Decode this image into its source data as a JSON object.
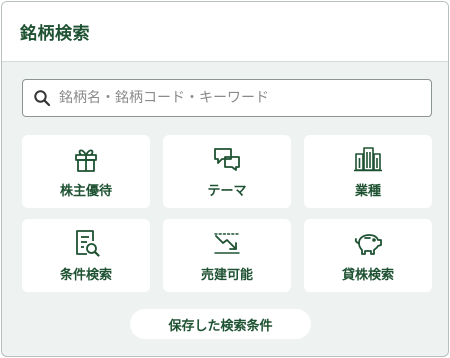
{
  "header": {
    "title": "銘柄検索"
  },
  "search": {
    "placeholder": "銘柄名・銘柄コード・キーワード",
    "icon": "search-icon"
  },
  "tiles": [
    {
      "label": "株主優待",
      "icon": "gift-icon"
    },
    {
      "label": "テーマ",
      "icon": "chat-bubbles-icon"
    },
    {
      "label": "業種",
      "icon": "buildings-icon"
    },
    {
      "label": "条件検索",
      "icon": "document-search-icon"
    },
    {
      "label": "売建可能",
      "icon": "downtrend-chart-icon"
    },
    {
      "label": "貸株検索",
      "icon": "piggy-bank-icon"
    }
  ],
  "saved_button": {
    "label": "保存した検索条件"
  },
  "colors": {
    "accent": "#1e5232",
    "background": "#eef3f2",
    "tile": "#ffffff"
  }
}
